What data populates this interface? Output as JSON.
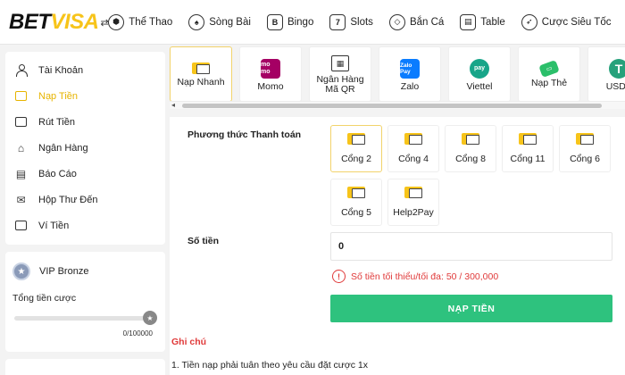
{
  "header": {
    "logo_bet": "BET",
    "logo_visa": "VISA",
    "logo_arrow": "⇄",
    "nav": [
      {
        "label": "Thể Thao",
        "icon": "soccer-ball-icon"
      },
      {
        "label": "Sòng Bài",
        "icon": "dealer-icon"
      },
      {
        "label": "Bingo",
        "icon": "bingo-icon"
      },
      {
        "label": "Slots",
        "icon": "slot-machine-icon"
      },
      {
        "label": "Bắn Cá",
        "icon": "fish-icon"
      },
      {
        "label": "Table",
        "icon": "table-game-icon"
      },
      {
        "label": "Cược Siêu Tốc",
        "icon": "rocket-icon"
      }
    ]
  },
  "sidebar": {
    "items": [
      {
        "label": "Tài Khoản",
        "icon": "user-icon"
      },
      {
        "label": "Nạp Tiền",
        "icon": "deposit-wallet-icon",
        "active": true
      },
      {
        "label": "Rút Tiền",
        "icon": "withdraw-icon"
      },
      {
        "label": "Ngân Hàng",
        "icon": "bank-icon"
      },
      {
        "label": "Báo Cáo",
        "icon": "report-icon"
      },
      {
        "label": "Hộp Thư Đến",
        "icon": "mail-icon"
      },
      {
        "label": "Ví Tiền",
        "icon": "wallet-icon"
      }
    ],
    "vip": {
      "level": "VIP Bronze",
      "bet_label": "Tổng tiền cược",
      "progress_value": "0/100000",
      "progress_fraction": 0.0
    }
  },
  "methods": [
    {
      "label": "Nạp Nhanh",
      "icon": "card-icon",
      "active": true
    },
    {
      "label": "Momo",
      "icon": "momo-icon",
      "glyph": "mo mo"
    },
    {
      "label": "Ngân Hàng Mã QR",
      "icon": "bank-qr-icon",
      "glyph": "▦"
    },
    {
      "label": "Zalo",
      "icon": "zalopay-icon",
      "glyph": "Zalo Pay"
    },
    {
      "label": "Viettel",
      "icon": "viettel-pay-icon",
      "glyph": "pay"
    },
    {
      "label": "Nạp Thẻ",
      "icon": "scratch-card-icon",
      "glyph": "▭"
    },
    {
      "label": "USDT",
      "icon": "tether-icon",
      "glyph": "T"
    }
  ],
  "payment": {
    "label": "Phương thức Thanh toán",
    "gates": [
      {
        "label": "Cổng 2",
        "active": true
      },
      {
        "label": "Cổng 4"
      },
      {
        "label": "Cổng 8"
      },
      {
        "label": "Cổng 11"
      },
      {
        "label": "Cổng 6"
      },
      {
        "label": "Cổng 5"
      },
      {
        "label": "Help2Pay"
      }
    ]
  },
  "amount": {
    "label": "Số tiền",
    "value": "0",
    "warning": "Số tiền tối thiểu/tối đa: 50 / 300,000",
    "warning_icon": "!"
  },
  "submit_label": "NẠP TIỀN",
  "notes": {
    "title": "Ghi chú",
    "items": [
      "1. Tiền nạp phải tuân theo yêu cầu đặt cược 1x"
    ]
  },
  "colors": {
    "accent_yellow": "#f7c41a",
    "active_text": "#e7b400",
    "submit_green": "#2ec27e",
    "warning_red": "#e03a3a"
  }
}
